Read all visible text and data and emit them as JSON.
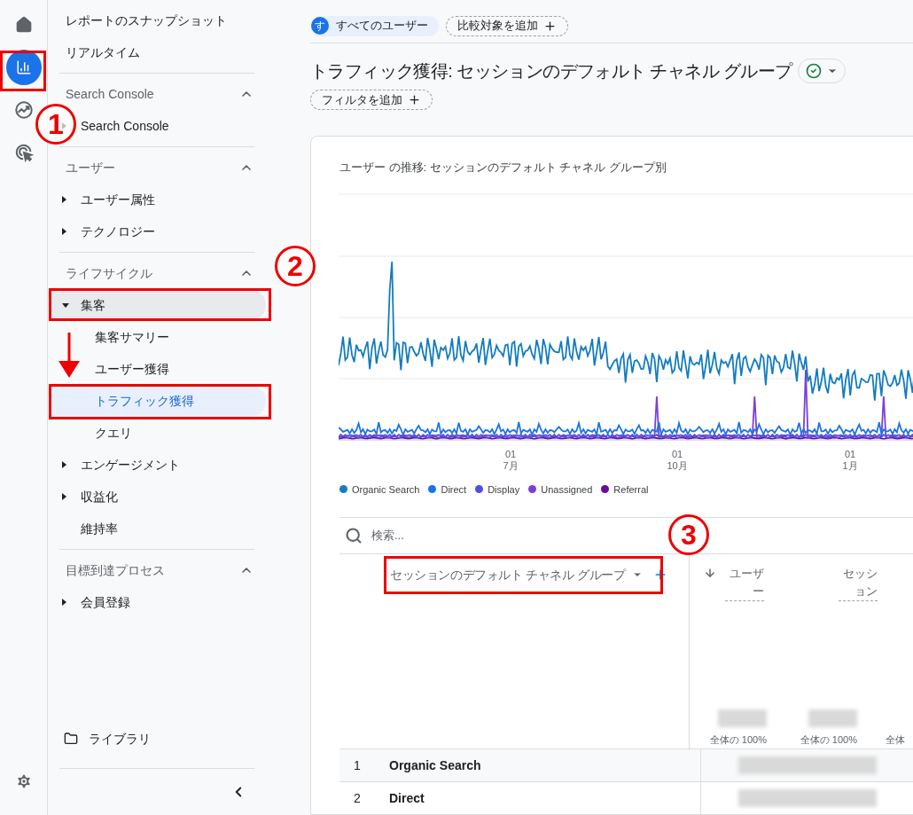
{
  "rail": [
    {
      "kind": "home",
      "selected": false
    },
    {
      "kind": "reports",
      "selected": true
    },
    {
      "kind": "explore",
      "selected": false
    },
    {
      "kind": "advertising",
      "selected": false
    }
  ],
  "sidebar": {
    "top_items": [
      "レポートのスナップショット",
      "リアルタイム"
    ],
    "sections": [
      {
        "title": "Search Console",
        "expanded": true,
        "items": [
          {
            "label": "Search Console",
            "expanded": false,
            "selected": false
          }
        ]
      },
      {
        "title": "ユーザー",
        "expanded": true,
        "items": [
          {
            "label": "ユーザー属性",
            "expanded": false,
            "selected": false
          },
          {
            "label": "テクノロジー",
            "expanded": false,
            "selected": false
          }
        ]
      },
      {
        "title": "ライフサイクル",
        "expanded": true,
        "items": [
          {
            "label": "集客",
            "expanded": true,
            "selected": false,
            "children": [
              {
                "label": "集客サマリー",
                "selected": false
              },
              {
                "label": "ユーザー獲得",
                "selected": false
              },
              {
                "label": "トラフィック獲得",
                "selected": true
              },
              {
                "label": "クエリ",
                "selected": false
              }
            ]
          },
          {
            "label": "エンゲージメント",
            "expanded": false,
            "selected": false
          },
          {
            "label": "収益化",
            "expanded": false,
            "selected": false
          },
          {
            "label": "維持率",
            "selected": false
          }
        ]
      },
      {
        "title": "目標到達プロセス",
        "expanded": true,
        "items": [
          {
            "label": "会員登録",
            "expanded": false,
            "selected": false
          }
        ]
      }
    ],
    "library": "ライブラリ"
  },
  "top_bar": {
    "segment": {
      "avatar": "す",
      "label": "すべてのユーザー"
    },
    "compare_button": "比較対象を追加"
  },
  "title": "トラフィック獲得: セッションのデフォルト チャネル グループ",
  "filter_button": "フィルタを追加",
  "chart": {
    "title": "ユーザー の推移: セッションのデフォルト チャネル グループ別",
    "x_labels": [
      {
        "day": "01",
        "month": "7月"
      },
      {
        "day": "01",
        "month": "10月"
      },
      {
        "day": "01",
        "month": "1月"
      }
    ],
    "legend": [
      {
        "label": "Organic Search",
        "color": "#137cbd"
      },
      {
        "label": "Direct",
        "color": "#1a73e8"
      },
      {
        "label": "Display",
        "color": "#4b4fe8"
      },
      {
        "label": "Unassigned",
        "color": "#7b3fd8"
      },
      {
        "label": "Referral",
        "color": "#6a0b9f"
      }
    ]
  },
  "table": {
    "search_placeholder": "検索...",
    "dimension": "セッションのデフォルト チャネル グループ",
    "columns": [
      {
        "label": "ユーザー",
        "sorted": true
      },
      {
        "label": "セッション",
        "sorted": false
      }
    ],
    "totals": [
      "全体の 100%",
      "全体の 100%",
      "全体"
    ],
    "rows": [
      {
        "index": "1",
        "name": "Organic Search"
      },
      {
        "index": "2",
        "name": "Direct"
      }
    ]
  },
  "annotations": [
    "1",
    "2",
    "3"
  ]
}
